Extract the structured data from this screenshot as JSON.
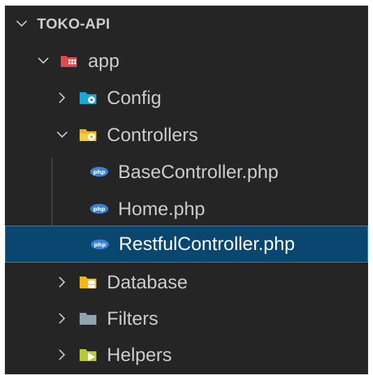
{
  "explorer": {
    "root_label": "TOKO-API",
    "items": [
      {
        "label": "app",
        "type": "folder-open",
        "icon": "app-folder-icon",
        "color": "#e5484d"
      },
      {
        "label": "Config",
        "type": "folder",
        "icon": "config-folder-icon",
        "color": "#20a4d6"
      },
      {
        "label": "Controllers",
        "type": "folder-open",
        "icon": "controllers-folder-icon",
        "color": "#e6b422"
      },
      {
        "label": "BaseController.php",
        "type": "file",
        "icon": "php-file-icon",
        "color": "#3b82d6"
      },
      {
        "label": "Home.php",
        "type": "file",
        "icon": "php-file-icon",
        "color": "#3b82d6"
      },
      {
        "label": "RestfulController.php",
        "type": "file",
        "icon": "php-file-icon",
        "color": "#3b82d6",
        "selected": true
      },
      {
        "label": "Database",
        "type": "folder",
        "icon": "database-folder-icon",
        "color": "#f2b51e"
      },
      {
        "label": "Filters",
        "type": "folder",
        "icon": "filters-folder-icon",
        "color": "#90a4ae"
      },
      {
        "label": "Helpers",
        "type": "folder",
        "icon": "helpers-folder-icon",
        "color": "#b7c93a"
      }
    ]
  },
  "colors": {
    "background": "#252526",
    "selection": "#094771",
    "selection_border": "#1e8ad6",
    "text": "#cccccc"
  }
}
